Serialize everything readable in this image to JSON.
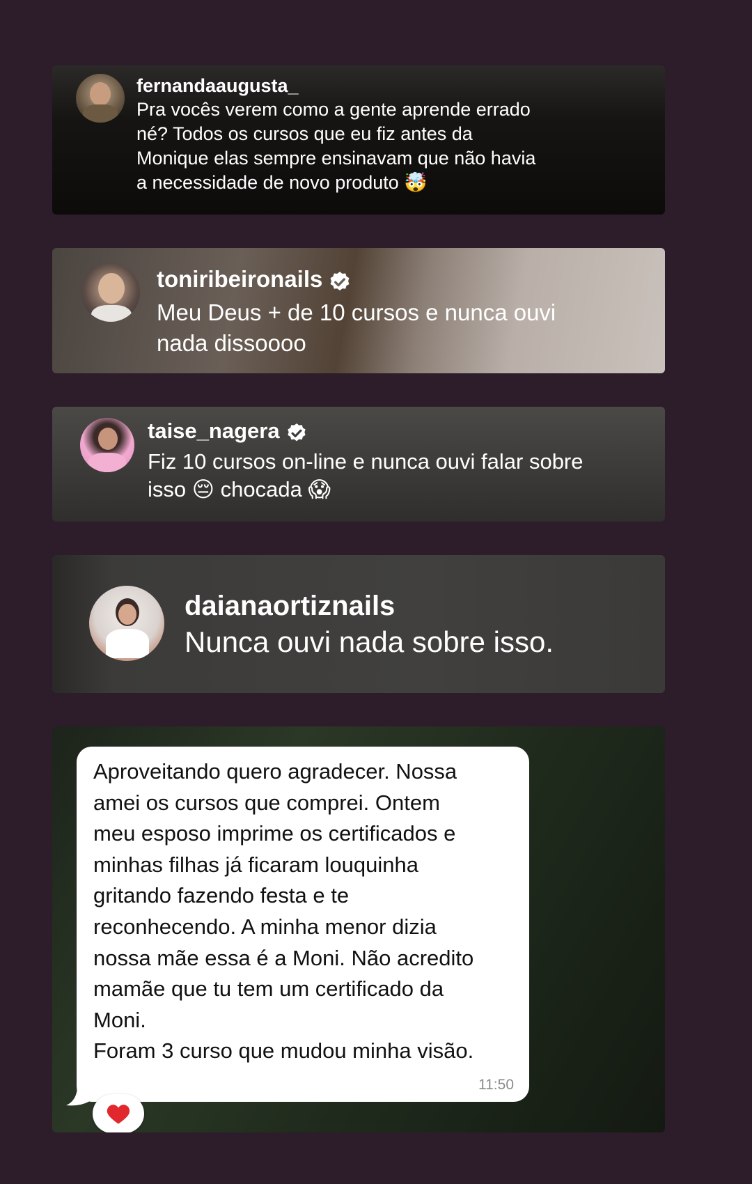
{
  "comments": [
    {
      "username": "fernandaaugusta_",
      "verified": false,
      "text": "Pra vocês verem como a gente aprende errado\nné? Todos os cursos que eu fiz antes da\nMonique elas sempre ensinavam que não havia\na necessidade de novo produto 🤯"
    },
    {
      "username": "toniribeironails",
      "verified": true,
      "text": "Meu Deus + de 10 cursos e nunca ouvi\nnada dissoooo"
    },
    {
      "username": "taise_nagera",
      "verified": true,
      "text": "Fiz 10 cursos on-line e nunca ouvi falar sobre\nisso 😔 chocada 😱"
    },
    {
      "username": "daianaortiznails",
      "verified": false,
      "text": "Nunca ouvi nada sobre isso."
    }
  ],
  "chat": {
    "message": "Aproveitando quero agradecer. Nossa\namei os cursos que comprei. Ontem\nmeu esposo imprime os certificados e\nminhas filhas já ficaram louquinha\ngritando fazendo festa e te\nreconhecendo. A minha menor dizia\nnossa mãe essa é a Moni. Não acredito\nmamãe que tu tem um certificado da\nMoni.\nForam 3 curso que mudou minha visão.",
    "time": "11:50",
    "reaction": "❤️"
  },
  "colors": {
    "page_background": "#2d1c2a",
    "verified_badge": "#ffffff",
    "reaction_heart": "#e0282e"
  },
  "icons": {
    "verified": "verified-badge-icon",
    "reaction": "heart-icon"
  }
}
